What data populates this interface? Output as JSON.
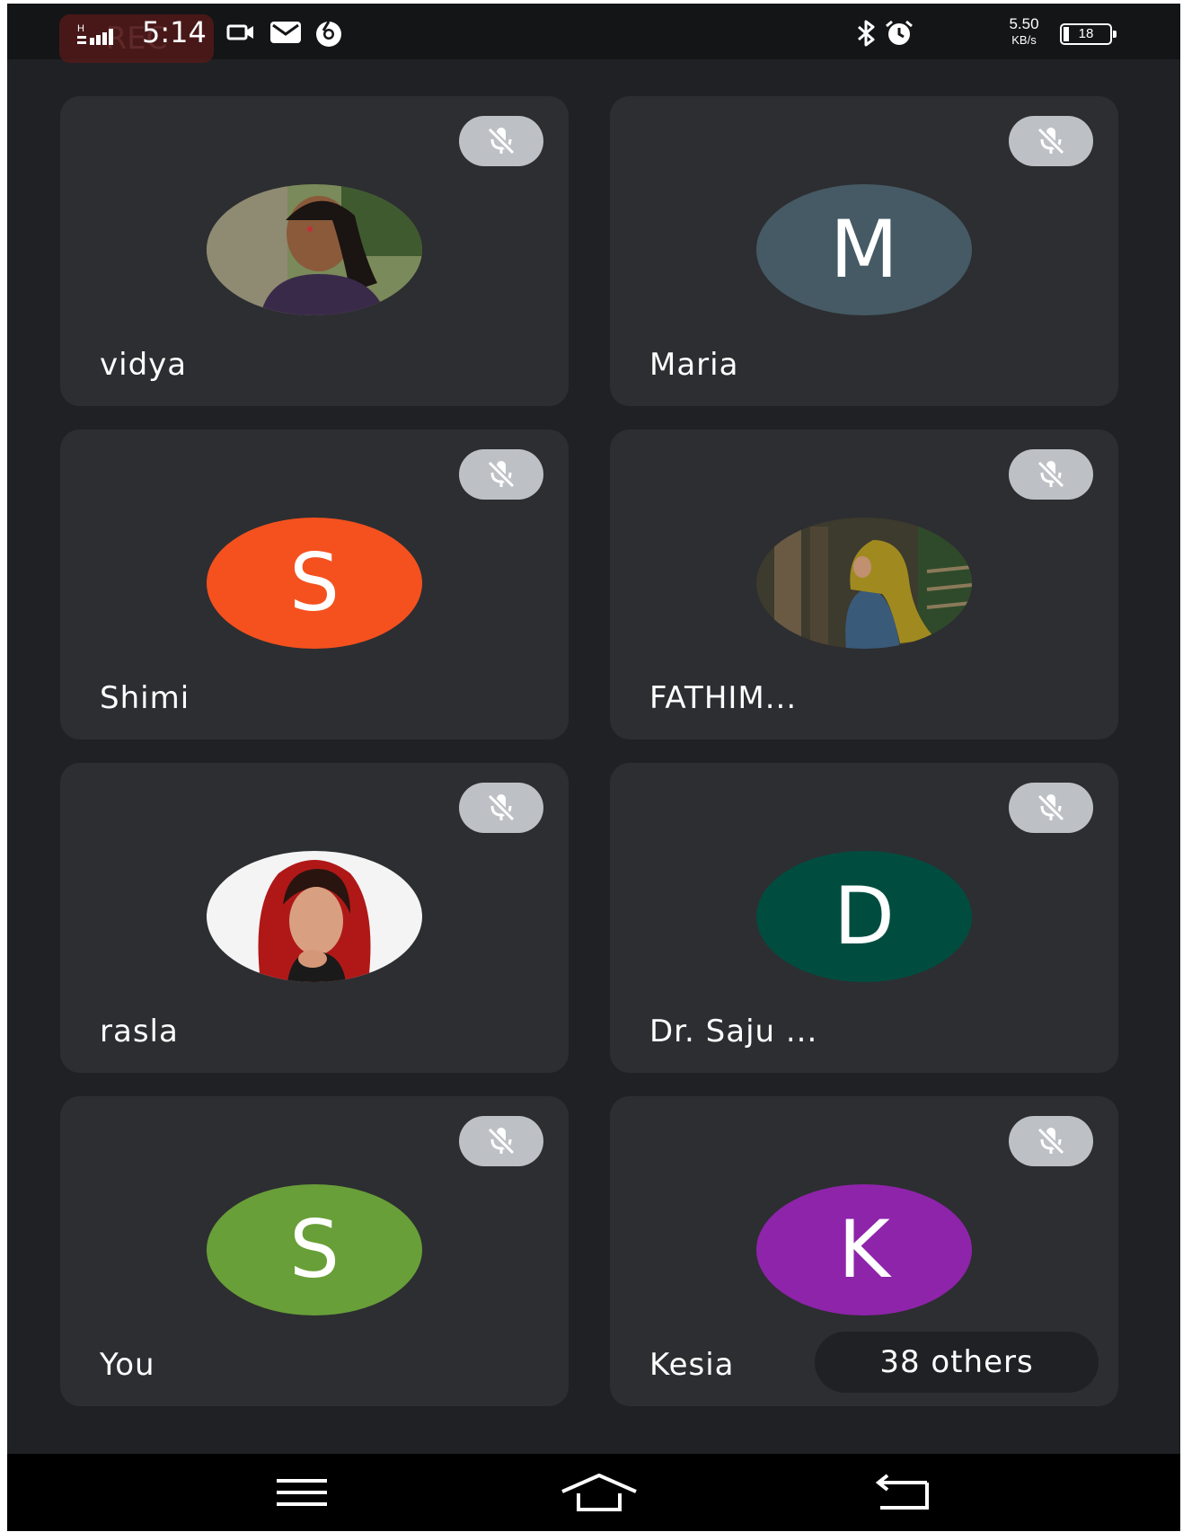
{
  "status_bar": {
    "rec_label": "REC",
    "time": "5:14",
    "net_speed_value": "5.50",
    "net_speed_unit": "KB/s",
    "battery_level": "18",
    "icons": [
      "signal-icon",
      "video-camera-icon",
      "mail-icon",
      "chrome-icon",
      "bluetooth-icon",
      "alarm-icon",
      "battery-icon"
    ]
  },
  "participants": [
    {
      "name": "vidya",
      "avatar_type": "photo",
      "muted": true
    },
    {
      "name": "Maria",
      "avatar_type": "initial",
      "initial": "M",
      "color": "#455a64",
      "muted": true
    },
    {
      "name": "Shimi",
      "avatar_type": "initial",
      "initial": "S",
      "color": "#f4511e",
      "muted": true
    },
    {
      "name": "FATHIM...",
      "avatar_type": "photo",
      "muted": true
    },
    {
      "name": "rasla",
      "avatar_type": "photo",
      "muted": true
    },
    {
      "name": "Dr. Saju ...",
      "avatar_type": "initial",
      "initial": "D",
      "color": "#004d40",
      "muted": true
    },
    {
      "name": "You",
      "avatar_type": "initial",
      "initial": "S",
      "color": "#689f38",
      "muted": true
    },
    {
      "name": "Kesia",
      "avatar_type": "initial",
      "initial": "K",
      "color": "#8e24aa",
      "muted": true
    }
  ],
  "others_label": "38 others",
  "nav_bar": {
    "buttons": [
      "menu-icon",
      "home-icon",
      "back-icon"
    ]
  }
}
